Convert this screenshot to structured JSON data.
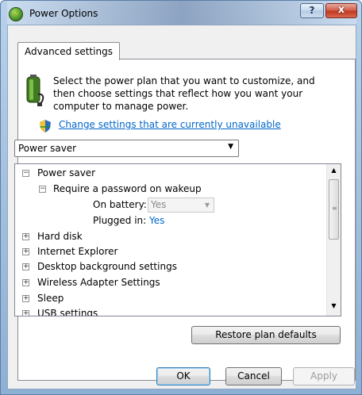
{
  "window": {
    "title": "Power Options",
    "help_label": "?",
    "close_label": "x"
  },
  "tab": {
    "label": "Advanced settings"
  },
  "intro": {
    "text": "Select the power plan that you want to customize, and then choose settings that reflect how you want your computer to manage power."
  },
  "change_link": {
    "label": "Change settings that are currently unavailable"
  },
  "plan_select": {
    "value": "Power saver"
  },
  "tree": {
    "root": {
      "label": "Power saver",
      "expanded": "⊟"
    },
    "password": {
      "label": "Require a password on wakeup",
      "expanded": "⊟"
    },
    "on_battery": {
      "label": "On battery:",
      "value": "Yes"
    },
    "plugged_in": {
      "label": "Plugged in:",
      "value": "Yes"
    },
    "items": [
      {
        "label": "Hard disk",
        "expanded": "⊞"
      },
      {
        "label": "Internet Explorer",
        "expanded": "⊞"
      },
      {
        "label": "Desktop background settings",
        "expanded": "⊞"
      },
      {
        "label": "Wireless Adapter Settings",
        "expanded": "⊞"
      },
      {
        "label": "Sleep",
        "expanded": "⊞"
      },
      {
        "label": "USB settings",
        "expanded": "⊞"
      }
    ]
  },
  "buttons": {
    "restore": "Restore plan defaults",
    "ok": "OK",
    "cancel": "Cancel",
    "apply": "Apply"
  },
  "icons": {
    "title": "power-options-icon",
    "intro": "battery-plug-icon",
    "shield": "uac-shield-icon",
    "help": "help-icon",
    "close": "close-icon"
  },
  "colors": {
    "link": "#0066cc",
    "frame": "#a8c3df",
    "close_button": "#c0381f"
  }
}
